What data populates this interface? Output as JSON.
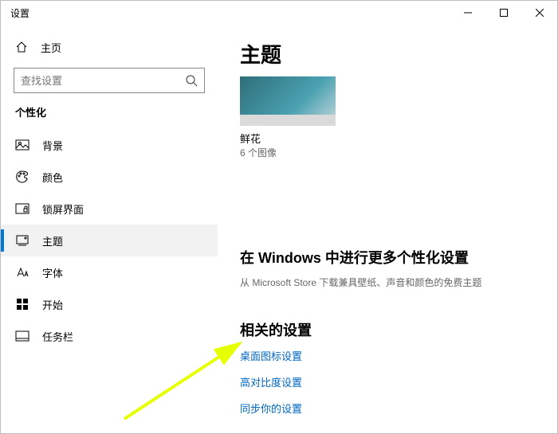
{
  "window": {
    "title": "设置"
  },
  "home": {
    "label": "主页"
  },
  "search": {
    "placeholder": "查找设置"
  },
  "section": {
    "title": "个性化"
  },
  "nav": {
    "background": "背景",
    "colors": "颜色",
    "lockscreen": "锁屏界面",
    "themes": "主题",
    "fonts": "字体",
    "start": "开始",
    "taskbar": "任务栏"
  },
  "main": {
    "title": "主题",
    "theme_name": "鲜花",
    "theme_sub": "6 个图像",
    "more_heading": "在 Windows 中进行更多个性化设置",
    "more_desc": "从 Microsoft Store 下载兼具壁纸、声音和颜色的免费主题",
    "related_heading": "相关的设置",
    "link_desktop_icons": "桌面图标设置",
    "link_high_contrast": "高对比度设置",
    "link_sync": "同步你的设置"
  }
}
